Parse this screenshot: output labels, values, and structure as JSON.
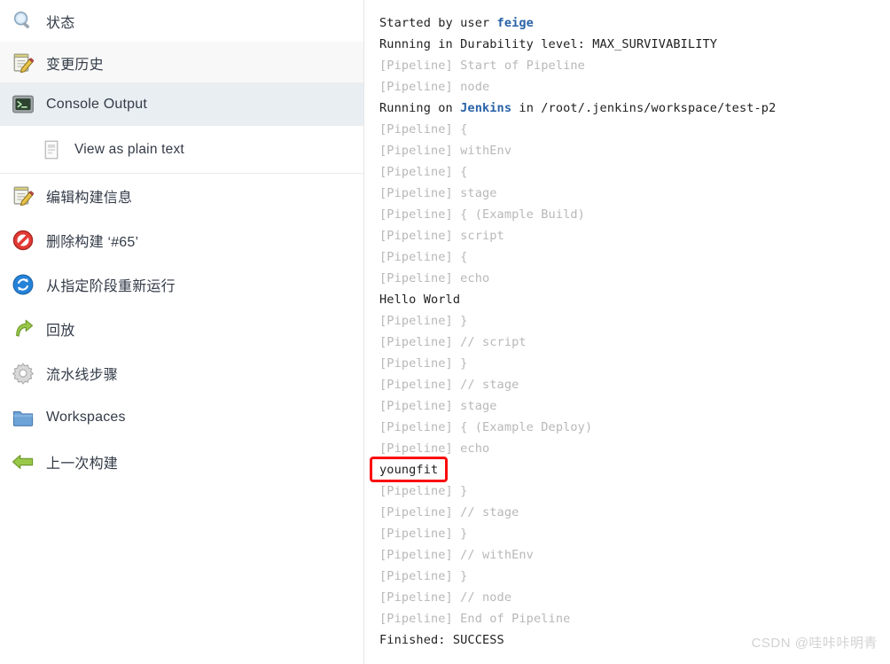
{
  "sidebar": {
    "items": [
      {
        "id": "status",
        "label": "状态",
        "icon": "magnifier-icon",
        "style": "plain",
        "indent": false
      },
      {
        "id": "changes",
        "label": "变更历史",
        "icon": "notepad-pencil-icon",
        "style": "alt",
        "indent": false
      },
      {
        "id": "console",
        "label": "Console Output",
        "icon": "terminal-icon",
        "style": "selected",
        "indent": false
      },
      {
        "id": "plaintext",
        "label": "View as plain text",
        "icon": "document-icon",
        "style": "sub",
        "indent": true
      },
      {
        "id": "edit-info",
        "label": "编辑构建信息",
        "icon": "notepad-pencil-icon",
        "style": "plain",
        "indent": false
      },
      {
        "id": "delete-build",
        "label": "删除构建 ‘#65’",
        "icon": "no-entry-icon",
        "style": "plain",
        "indent": false
      },
      {
        "id": "restart-stage",
        "label": "从指定阶段重新运行",
        "icon": "refresh-icon",
        "style": "plain",
        "indent": false
      },
      {
        "id": "replay",
        "label": "回放",
        "icon": "replay-arrow-icon",
        "style": "plain",
        "indent": false
      },
      {
        "id": "pipeline-steps",
        "label": "流水线步骤",
        "icon": "gear-icon",
        "style": "plain",
        "indent": false
      },
      {
        "id": "workspaces",
        "label": "Workspaces",
        "icon": "folder-icon",
        "style": "plain",
        "indent": false
      },
      {
        "id": "previous-build",
        "label": "上一次构建",
        "icon": "back-arrow-icon",
        "style": "plain",
        "indent": false
      }
    ]
  },
  "console": {
    "lines": [
      {
        "text": "Started by user ",
        "kind": "normal",
        "link": "feige",
        "after": ""
      },
      {
        "text": "Running in Durability level: MAX_SURVIVABILITY",
        "kind": "normal"
      },
      {
        "text": "[Pipeline] Start of Pipeline",
        "kind": "pipeline"
      },
      {
        "text": "[Pipeline] node",
        "kind": "pipeline"
      },
      {
        "text": "Running on ",
        "kind": "normal",
        "link": "Jenkins",
        "after": " in /root/.jenkins/workspace/test-p2"
      },
      {
        "text": "[Pipeline] {",
        "kind": "pipeline"
      },
      {
        "text": "[Pipeline] withEnv",
        "kind": "pipeline"
      },
      {
        "text": "[Pipeline] {",
        "kind": "pipeline"
      },
      {
        "text": "[Pipeline] stage",
        "kind": "pipeline"
      },
      {
        "text": "[Pipeline] { (Example Build)",
        "kind": "pipeline"
      },
      {
        "text": "[Pipeline] script",
        "kind": "pipeline"
      },
      {
        "text": "[Pipeline] {",
        "kind": "pipeline"
      },
      {
        "text": "[Pipeline] echo",
        "kind": "pipeline"
      },
      {
        "text": "Hello World",
        "kind": "normal"
      },
      {
        "text": "[Pipeline] }",
        "kind": "pipeline"
      },
      {
        "text": "[Pipeline] // script",
        "kind": "pipeline"
      },
      {
        "text": "[Pipeline] }",
        "kind": "pipeline"
      },
      {
        "text": "[Pipeline] // stage",
        "kind": "pipeline"
      },
      {
        "text": "[Pipeline] stage",
        "kind": "pipeline"
      },
      {
        "text": "[Pipeline] { (Example Deploy)",
        "kind": "pipeline"
      },
      {
        "text": "[Pipeline] echo",
        "kind": "pipeline"
      },
      {
        "text": "youngfit",
        "kind": "normal",
        "highlighted": true
      },
      {
        "text": "[Pipeline] }",
        "kind": "pipeline"
      },
      {
        "text": "[Pipeline] // stage",
        "kind": "pipeline"
      },
      {
        "text": "[Pipeline] }",
        "kind": "pipeline"
      },
      {
        "text": "[Pipeline] // withEnv",
        "kind": "pipeline"
      },
      {
        "text": "[Pipeline] }",
        "kind": "pipeline"
      },
      {
        "text": "[Pipeline] // node",
        "kind": "pipeline"
      },
      {
        "text": "[Pipeline] End of Pipeline",
        "kind": "pipeline"
      },
      {
        "text": "Finished: SUCCESS",
        "kind": "normal"
      }
    ]
  },
  "annotation": {
    "target_text": "youngfit",
    "color": "#fb0b0b"
  },
  "watermark": {
    "text": "CSDN @哇咔咔明青"
  },
  "colors": {
    "pipeline_text": "#b8b8b8",
    "normal_text": "#1f1f1f",
    "link": "#2a63a8",
    "selected_row": "#e9eef2",
    "alt_row": "#f8f8f8",
    "annotation": "#fb0b0b",
    "watermark": "#d2d2d2"
  }
}
